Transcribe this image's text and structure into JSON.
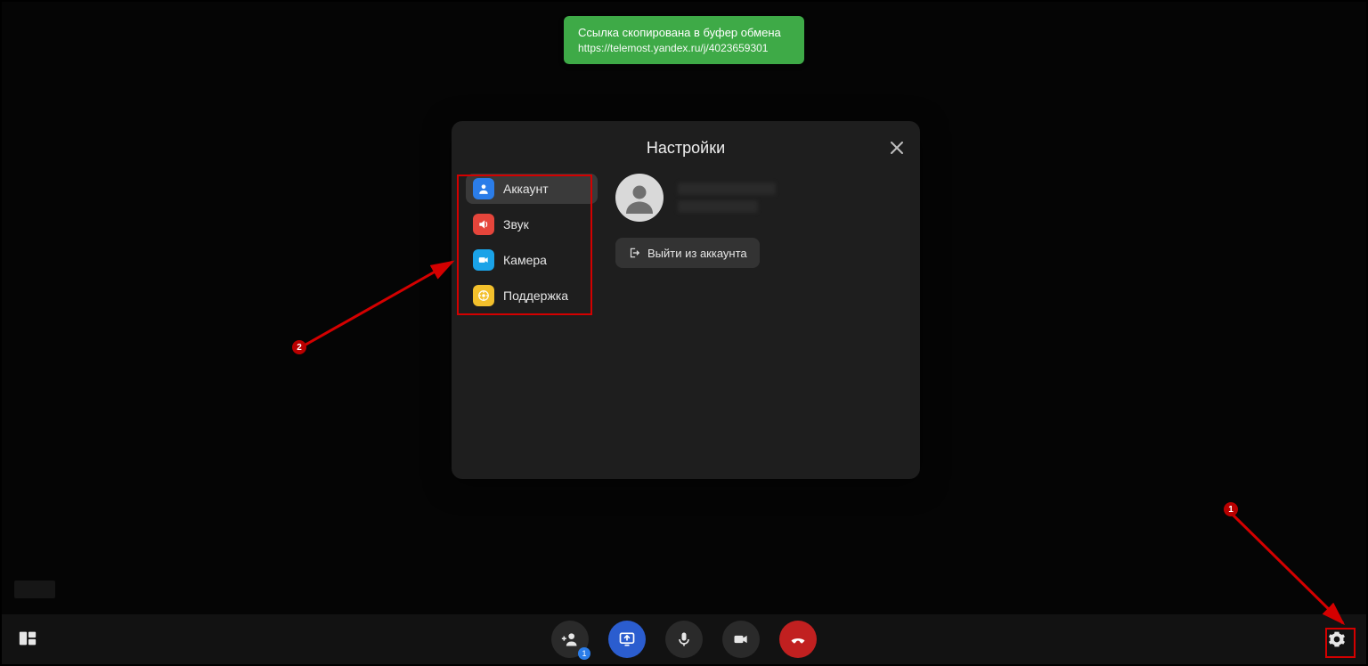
{
  "toast": {
    "line1": "Ссылка скопирована в буфер обмена",
    "line2": "https://telemost.yandex.ru/j/4023659301"
  },
  "dialog": {
    "title": "Настройки",
    "close_aria": "Закрыть"
  },
  "sidebar": {
    "items": [
      {
        "label": "Аккаунт",
        "icon": "account",
        "active": true
      },
      {
        "label": "Звук",
        "icon": "sound",
        "active": false
      },
      {
        "label": "Камера",
        "icon": "camera",
        "active": false
      },
      {
        "label": "Поддержка",
        "icon": "support",
        "active": false
      }
    ]
  },
  "account": {
    "logout_label": "Выйти из аккаунта"
  },
  "toolbar": {
    "add_participant_badge": "1"
  },
  "annotations": {
    "step1": "1",
    "step2": "2"
  }
}
